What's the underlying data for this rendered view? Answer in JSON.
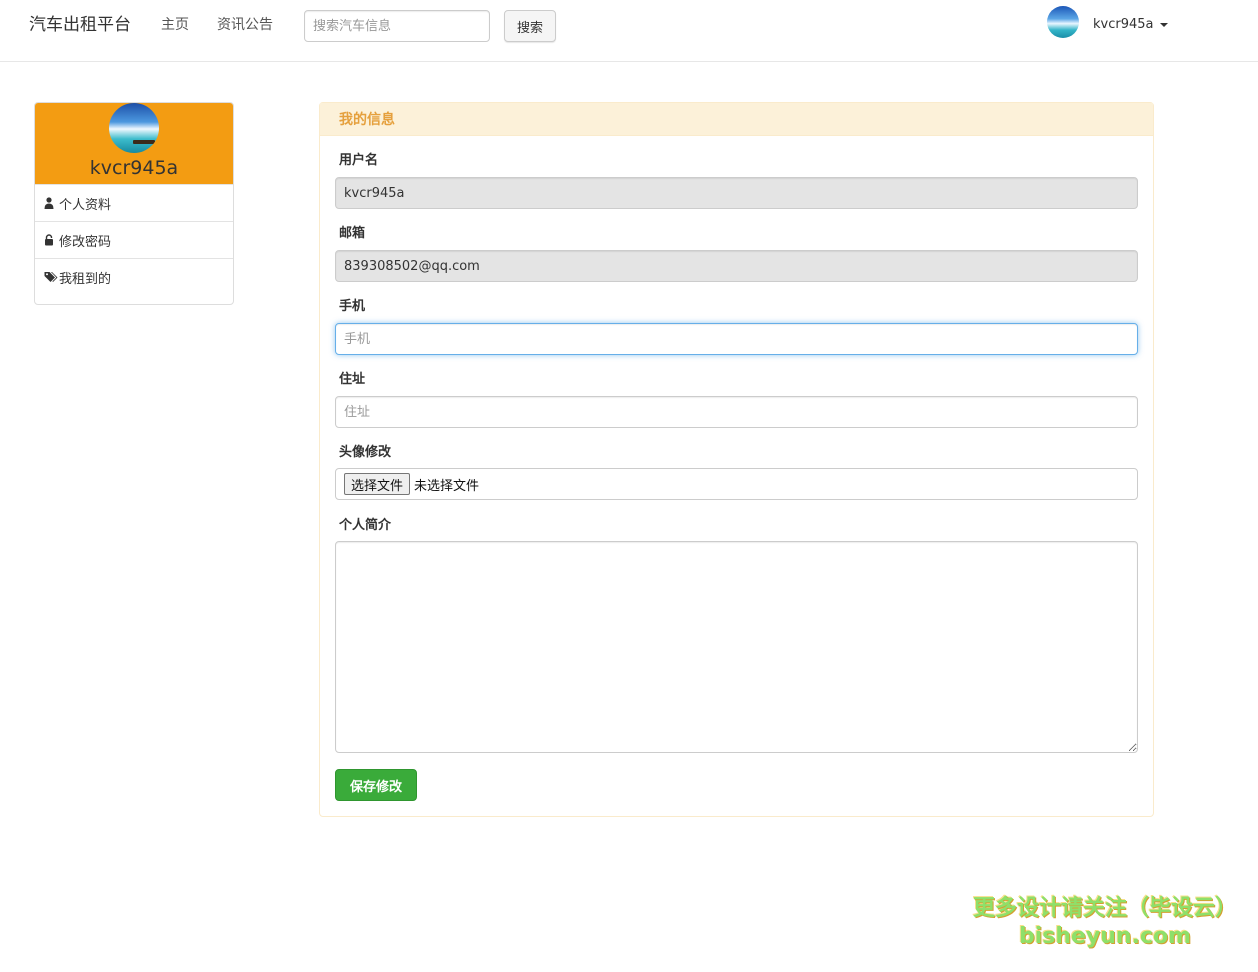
{
  "navbar": {
    "brand": "汽车出租平台",
    "links": [
      {
        "label": "主页"
      },
      {
        "label": "资讯公告"
      }
    ],
    "search_placeholder": "搜索汽车信息",
    "search_button": "搜索",
    "username": "kvcr945a"
  },
  "sidebar": {
    "username": "kvcr945a",
    "items": [
      {
        "label": "个人资料",
        "icon": "user-icon"
      },
      {
        "label": "修改密码",
        "icon": "lock-icon"
      },
      {
        "label": "我租到的",
        "icon": "tags-icon"
      }
    ]
  },
  "panel": {
    "title": "我的信息",
    "fields": {
      "username": {
        "label": "用户名",
        "value": "kvcr945a"
      },
      "email": {
        "label": "邮箱",
        "value": "839308502@qq.com"
      },
      "phone": {
        "label": "手机",
        "placeholder": "手机"
      },
      "address": {
        "label": "住址",
        "placeholder": "住址"
      },
      "avatar": {
        "label": "头像修改",
        "button": "选择文件",
        "status": "未选择文件"
      },
      "bio": {
        "label": "个人简介"
      }
    },
    "save_button": "保存修改"
  },
  "watermark": {
    "line1": "更多设计请关注（毕设云）",
    "line2": "bisheyun.com"
  },
  "colors": {
    "sidebar_header": "#f39c12",
    "panel_border": "#faebcc",
    "panel_heading_text": "#e5a03d",
    "save_button": "#3aab3a"
  }
}
